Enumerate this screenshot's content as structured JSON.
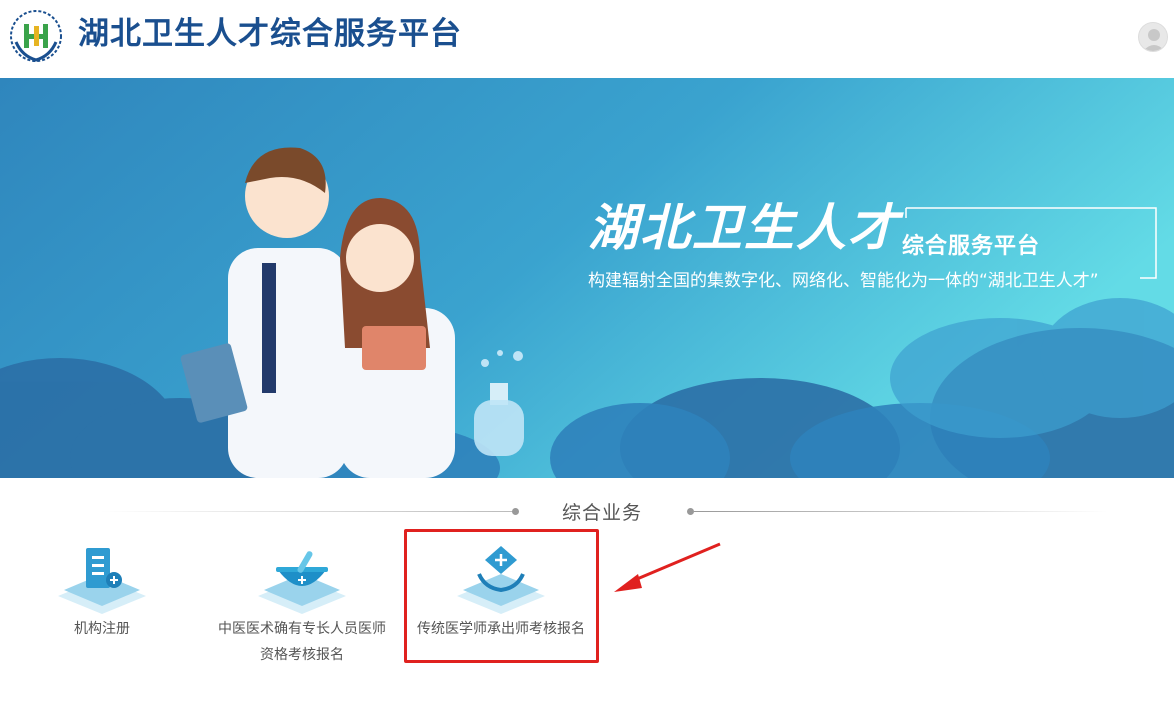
{
  "header": {
    "title": "湖北卫生人才综合服务平台"
  },
  "banner": {
    "title": "湖北卫生人才",
    "subtitle": "综合服务平台",
    "slogan": "构建辐射全国的集数字化、网络化、智能化为一体的“湖北卫生人才”"
  },
  "section": {
    "title": "综合业务"
  },
  "services": [
    {
      "label_lines": [
        "机构注册"
      ]
    },
    {
      "label_lines": [
        "中医医术确有专长人员医师",
        "资格考核报名"
      ]
    },
    {
      "label_lines": [
        "传统医学师承出师考核报名"
      ]
    }
  ],
  "colors": {
    "brand": "#1a4f8f",
    "highlight": "#e0211f",
    "banner_top": "#5fc9e0",
    "banner_bottom": "#2f7fb5"
  },
  "icons": [
    "logo-icon",
    "user-avatar-icon",
    "building-icon",
    "mortar-bowl-icon",
    "medical-hands-icon",
    "arrow-icon"
  ]
}
